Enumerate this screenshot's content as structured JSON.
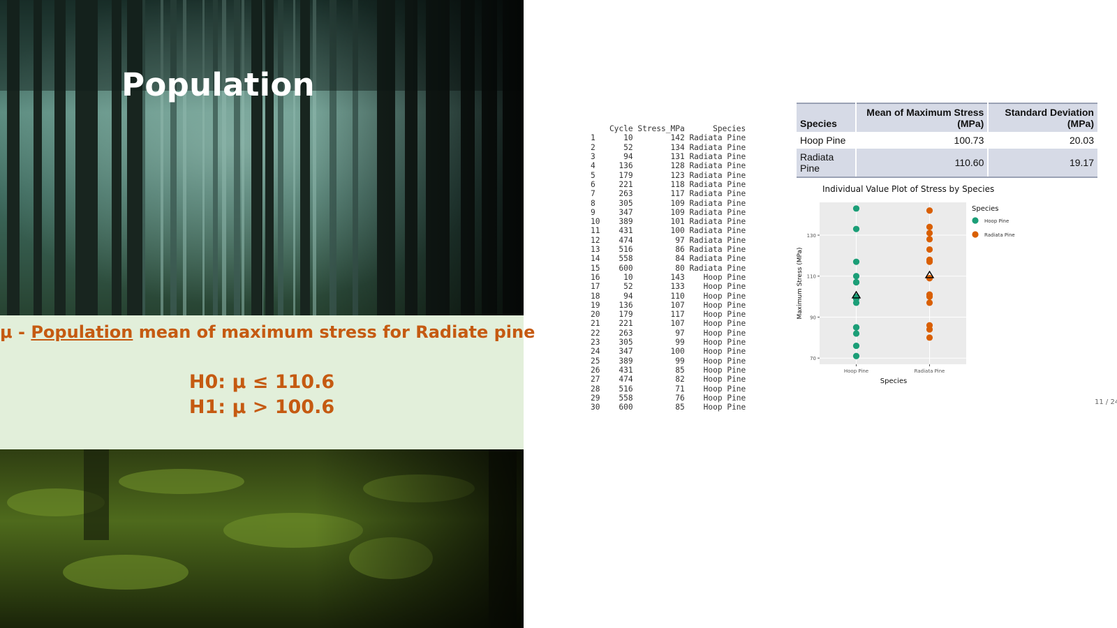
{
  "slide": {
    "title": "Population",
    "hypothesis_prefix": "μ - ",
    "hypothesis_underlined": "Population",
    "hypothesis_rest": " mean of maximum stress for Radiate pine",
    "h0": "H0: μ ≤ 110.6",
    "h1": "H1: μ > 100.6",
    "page_number": "11 / 24"
  },
  "colors": {
    "accent_orange": "#c55a11",
    "hyp_box_bg": "#e2efda",
    "hoop_pine": "#1b9e77",
    "radiata_pine": "#d95f02"
  },
  "data_table": {
    "headers": [
      "Cycle",
      "Stress_MPa",
      "Species"
    ],
    "rows": [
      [
        "1",
        "10",
        "142",
        "Radiata Pine"
      ],
      [
        "2",
        "52",
        "134",
        "Radiata Pine"
      ],
      [
        "3",
        "94",
        "131",
        "Radiata Pine"
      ],
      [
        "4",
        "136",
        "128",
        "Radiata Pine"
      ],
      [
        "5",
        "179",
        "123",
        "Radiata Pine"
      ],
      [
        "6",
        "221",
        "118",
        "Radiata Pine"
      ],
      [
        "7",
        "263",
        "117",
        "Radiata Pine"
      ],
      [
        "8",
        "305",
        "109",
        "Radiata Pine"
      ],
      [
        "9",
        "347",
        "109",
        "Radiata Pine"
      ],
      [
        "10",
        "389",
        "101",
        "Radiata Pine"
      ],
      [
        "11",
        "431",
        "100",
        "Radiata Pine"
      ],
      [
        "12",
        "474",
        "97",
        "Radiata Pine"
      ],
      [
        "13",
        "516",
        "86",
        "Radiata Pine"
      ],
      [
        "14",
        "558",
        "84",
        "Radiata Pine"
      ],
      [
        "15",
        "600",
        "80",
        "Radiata Pine"
      ],
      [
        "16",
        "10",
        "143",
        "Hoop Pine"
      ],
      [
        "17",
        "52",
        "133",
        "Hoop Pine"
      ],
      [
        "18",
        "94",
        "110",
        "Hoop Pine"
      ],
      [
        "19",
        "136",
        "107",
        "Hoop Pine"
      ],
      [
        "20",
        "179",
        "117",
        "Hoop Pine"
      ],
      [
        "21",
        "221",
        "107",
        "Hoop Pine"
      ],
      [
        "22",
        "263",
        "97",
        "Hoop Pine"
      ],
      [
        "23",
        "305",
        "99",
        "Hoop Pine"
      ],
      [
        "24",
        "347",
        "100",
        "Hoop Pine"
      ],
      [
        "25",
        "389",
        "99",
        "Hoop Pine"
      ],
      [
        "26",
        "431",
        "85",
        "Hoop Pine"
      ],
      [
        "27",
        "474",
        "82",
        "Hoop Pine"
      ],
      [
        "28",
        "516",
        "71",
        "Hoop Pine"
      ],
      [
        "29",
        "558",
        "76",
        "Hoop Pine"
      ],
      [
        "30",
        "600",
        "85",
        "Hoop Pine"
      ]
    ]
  },
  "summary": {
    "headers": [
      "Species",
      "Mean of Maximum Stress (MPa)",
      "Standard Deviation (MPa)"
    ],
    "rows": [
      [
        "Hoop Pine",
        "100.73",
        "20.03"
      ],
      [
        "Radiata Pine",
        "110.60",
        "19.17"
      ]
    ]
  },
  "chart_data": {
    "type": "scatter",
    "title": "Individual Value Plot of Stress by Species",
    "xlabel": "Species",
    "ylabel": "Maximum Stress (MPa)",
    "categories": [
      "Hoop Pine",
      "Radiata Pine"
    ],
    "ylim": [
      67,
      146
    ],
    "yticks": [
      70,
      90,
      110,
      130
    ],
    "grid": true,
    "legend_title": "Species",
    "legend_position": "right",
    "series": [
      {
        "name": "Hoop Pine",
        "color": "#1b9e77",
        "values": [
          143,
          133,
          110,
          107,
          117,
          107,
          97,
          99,
          100,
          99,
          85,
          82,
          71,
          76,
          85
        ],
        "mean": 100.73
      },
      {
        "name": "Radiata Pine",
        "color": "#d95f02",
        "values": [
          142,
          134,
          131,
          128,
          123,
          118,
          117,
          109,
          109,
          101,
          100,
          97,
          86,
          84,
          80
        ],
        "mean": 110.6
      }
    ],
    "mean_marker": "triangle"
  }
}
